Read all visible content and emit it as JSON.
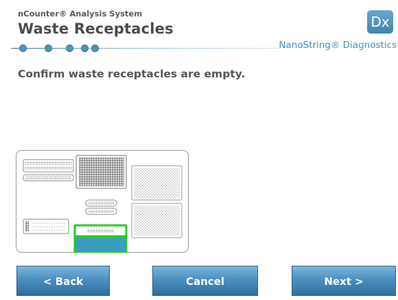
{
  "header": {
    "app_title": "nCounter® Analysis System",
    "page_title": "Waste Receptacles",
    "brand": "NanoString® Diagnostics",
    "badge": "Dx"
  },
  "progress": {
    "steps_total": 5,
    "steps_shown": 5
  },
  "main": {
    "instruction": "Confirm waste receptacles are empty."
  },
  "deck": {
    "strip_top_label": "○○○○○○○○○○○",
    "strip_mid_label": "○○○○○○",
    "small_labels": [
      "//////",
      "○○○○○○"
    ],
    "highlight_color": "#22cc22",
    "waste_fill_color": "#3b9cbf"
  },
  "buttons": {
    "back": {
      "label": "<  Back"
    },
    "cancel": {
      "label": "Cancel"
    },
    "next": {
      "label": "Next  >"
    }
  },
  "colors": {
    "accent": "#3f8fbf",
    "button": "#4b8fc0",
    "title": "#4b4b4b"
  }
}
